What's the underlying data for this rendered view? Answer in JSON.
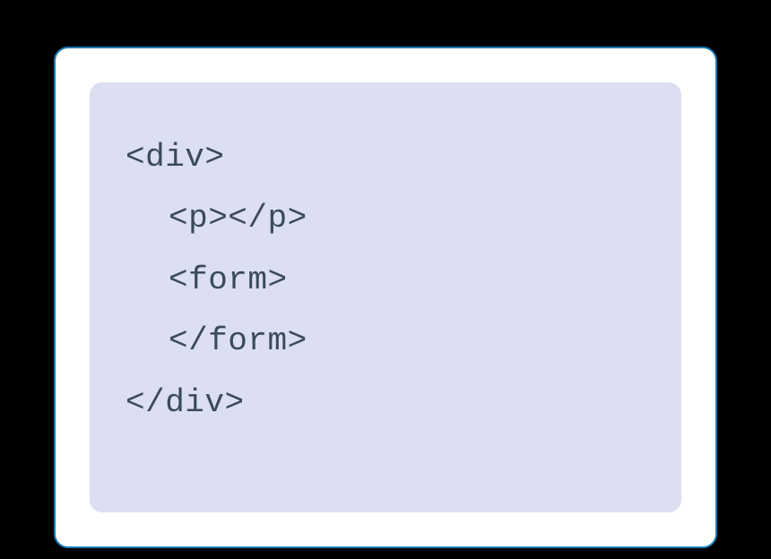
{
  "code": {
    "line1": "<div>",
    "line2": "<p></p>",
    "line3": "<form>",
    "line4": "</form>",
    "line5": "</div>"
  }
}
